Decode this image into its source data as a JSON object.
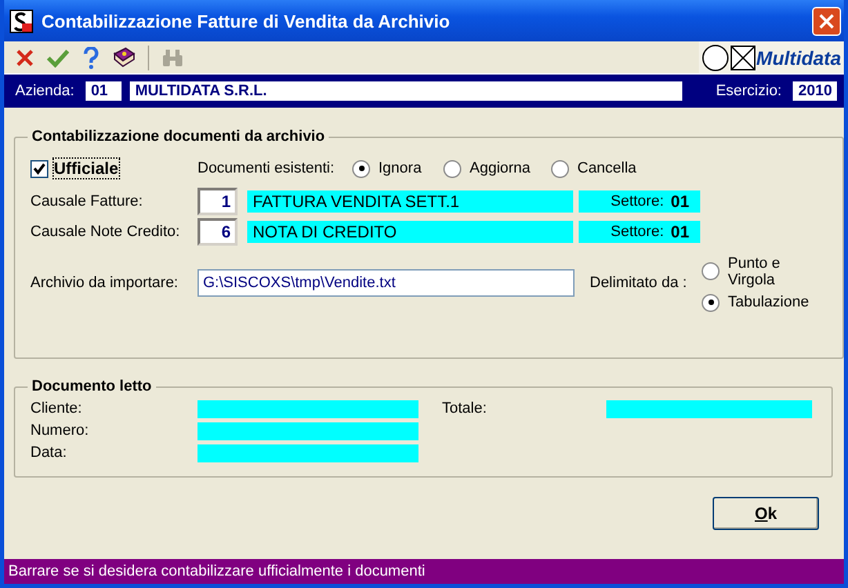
{
  "window": {
    "title": "Contabilizzazione Fatture di Vendita da Archivio"
  },
  "toolbar": {
    "buttons": [
      {
        "kind": "cancel",
        "disabled": false
      },
      {
        "kind": "confirm",
        "disabled": false
      },
      {
        "kind": "help",
        "disabled": false
      },
      {
        "kind": "book",
        "disabled": false
      },
      {
        "kind": "search",
        "disabled": true
      }
    ],
    "brand": "Multidata"
  },
  "company": {
    "label": "Azienda:",
    "code": "01",
    "name": "MULTIDATA S.R.L.",
    "year_label": "Esercizio:",
    "year": "2010"
  },
  "import_group": {
    "title": "Contabilizzazione documenti da archivio",
    "official": {
      "label": "Ufficiale",
      "checked": true
    },
    "existing": {
      "label": "Documenti esistenti:",
      "options": [
        {
          "label": "Ignora",
          "selected": true
        },
        {
          "label": "Aggiorna",
          "selected": false
        },
        {
          "label": "Cancella",
          "selected": false
        }
      ]
    },
    "causali": [
      {
        "label": "Causale Fatture:",
        "code": "1",
        "description": "FATTURA VENDITA SETT.1",
        "sector_label": "Settore:",
        "sector": "01"
      },
      {
        "label": "Causale Note Credito:",
        "code": "6",
        "description": "NOTA DI CREDITO",
        "sector_label": "Settore:",
        "sector": "01"
      }
    ],
    "archive": {
      "label": "Archivio da importare:",
      "value": "G:\\SISCOXS\\tmp\\Vendite.txt"
    },
    "delimiter": {
      "label": "Delimitato da :",
      "options": [
        {
          "label": "Punto e Virgola",
          "selected": false
        },
        {
          "label": "Tabulazione",
          "selected": true
        }
      ]
    }
  },
  "document_group": {
    "title": "Documento letto",
    "fields": [
      {
        "label": "Cliente:"
      },
      {
        "label": "Numero:"
      },
      {
        "label": "Data:"
      }
    ],
    "total_label": "Totale:"
  },
  "ok_button": "Ok",
  "status_bar": "Barrare se si desidera contabilizzare ufficialmente i documenti"
}
